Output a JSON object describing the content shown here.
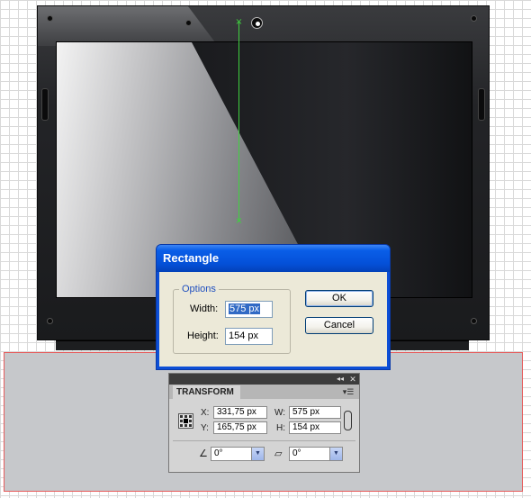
{
  "dialog": {
    "title": "Rectangle",
    "options_legend": "Options",
    "width_label": "Width:",
    "width_value": "575 px",
    "height_label": "Height:",
    "height_value": "154 px",
    "ok_label": "OK",
    "cancel_label": "Cancel"
  },
  "transform_panel": {
    "tab_label": "TRANSFORM",
    "collapse_glyph": "◂◂",
    "close_glyph": "✕",
    "menu_glyph": "▾☰",
    "x_label": "X:",
    "x_value": "331,75 px",
    "y_label": "Y:",
    "y_value": "165,75 px",
    "w_label": "W:",
    "w_value": "575 px",
    "h_label": "H:",
    "h_value": "154 px",
    "rotate_icon": "∠",
    "rotate_value": "0°",
    "shear_icon": "▱",
    "shear_value": "0°"
  },
  "colors": {
    "guide_line": "#3fd23f",
    "dialog_title_bar": "#0450d8",
    "selection_outline": "#e65a5a"
  }
}
